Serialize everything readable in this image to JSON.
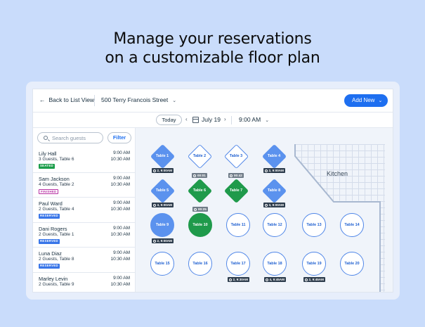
{
  "headline": {
    "line1": "Manage your reservations",
    "line2": "on a customizable floor plan"
  },
  "topbar": {
    "back_label": "Back to List View",
    "address": "500 Terry Francois Street",
    "add_new_label": "Add New"
  },
  "datebar": {
    "today_label": "Today",
    "date": "July 19",
    "time": "9:00 AM"
  },
  "sidebar": {
    "search_placeholder": "Search guests",
    "filter_label": "Filter",
    "guests": [
      {
        "name": "Lily Hall",
        "details": "3 Guests, Table 6",
        "badge": "SEATED",
        "badge_color": "#1b9d4a",
        "time_start": "9:00 AM",
        "time_end": "10:30 AM"
      },
      {
        "name": "Sam Jackson",
        "details": "4 Guests, Table 2",
        "badge": "FINISHED",
        "badge_color": "#b72fa3",
        "time_start": "9:00 AM",
        "time_end": "10:30 AM"
      },
      {
        "name": "Paul Ward",
        "details": "2 Guests, Table 4",
        "badge": "RESERVED",
        "badge_color": "#3875e8",
        "time_start": "9:00 AM",
        "time_end": "10:30 AM"
      },
      {
        "name": "Dani Rogers",
        "details": "2 Guests, Table 1",
        "badge": "RESERVED",
        "badge_color": "#3875e8",
        "time_start": "9:00 AM",
        "time_end": "10:30 AM"
      },
      {
        "name": "Luna Diaz",
        "details": "2 Guests, Table 8",
        "badge": "RESERVED",
        "badge_color": "#3875e8",
        "time_start": "9:00 AM",
        "time_end": "10:30 AM"
      },
      {
        "name": "Marley Levin",
        "details": "2 Guests, Table 9",
        "badge": "",
        "badge_color": "",
        "time_start": "9:00 AM",
        "time_end": "10:30 AM"
      }
    ]
  },
  "floor": {
    "kitchen_label": "Kitchen",
    "tables": [
      {
        "label": "Table 1",
        "shape": "diamond",
        "status": "reserved",
        "tag": "2, 9:00AM",
        "tag_type": "guests"
      },
      {
        "label": "Table 2",
        "shape": "diamond",
        "status": "free",
        "tag": "",
        "tag_type": ""
      },
      {
        "label": "Table 3",
        "shape": "diamond",
        "status": "free",
        "tag": "",
        "tag_type": ""
      },
      {
        "label": "Table 4",
        "shape": "diamond",
        "status": "reserved",
        "tag": "2, 9:00AM",
        "tag_type": "guests"
      },
      {
        "label": "Table 5",
        "shape": "diamond",
        "status": "reserved",
        "tag": "3, 9:00AM",
        "tag_type": "guests"
      },
      {
        "label": "Table 6",
        "shape": "diamond",
        "status": "seated",
        "tag": "00:01",
        "tag_type": "timer"
      },
      {
        "label": "Table 7",
        "shape": "diamond",
        "status": "seated",
        "tag": "00:42",
        "tag_type": "timer"
      },
      {
        "label": "Table 8",
        "shape": "diamond",
        "status": "reserved",
        "tag": "3, 9:00AM",
        "tag_type": "guests"
      },
      {
        "label": "Table 9",
        "shape": "circle",
        "status": "reserved",
        "tag": "2, 9:00AM",
        "tag_type": "guests"
      },
      {
        "label": "Table 10",
        "shape": "circle",
        "status": "seated",
        "tag": "00:25",
        "tag_type": "timer"
      },
      {
        "label": "Table 11",
        "shape": "circle",
        "status": "free",
        "tag": "",
        "tag_type": ""
      },
      {
        "label": "Table 12",
        "shape": "circle",
        "status": "free",
        "tag": "",
        "tag_type": ""
      },
      {
        "label": "Table 13",
        "shape": "circle",
        "status": "free",
        "tag": "",
        "tag_type": ""
      },
      {
        "label": "Table 14",
        "shape": "circle",
        "status": "free",
        "tag": "",
        "tag_type": ""
      },
      {
        "label": "Table 15",
        "shape": "circle",
        "status": "free",
        "tag": "",
        "tag_type": ""
      },
      {
        "label": "Table 16",
        "shape": "circle",
        "status": "free",
        "tag": "",
        "tag_type": ""
      },
      {
        "label": "Table 17",
        "shape": "circle",
        "status": "free",
        "tag": "2, 9:30AM",
        "tag_type": "guests"
      },
      {
        "label": "Table 18",
        "shape": "circle",
        "status": "free",
        "tag": "4, 9:45AM",
        "tag_type": "guests"
      },
      {
        "label": "Table 19",
        "shape": "circle",
        "status": "free",
        "tag": "2, 9:45AM",
        "tag_type": "guests"
      },
      {
        "label": "Table 20",
        "shape": "circle",
        "status": "free",
        "tag": "",
        "tag_type": ""
      }
    ]
  },
  "colors": {
    "accent": "#1e6ff0",
    "reserved": "#5b92ee",
    "seated": "#1f9a4b",
    "free_border": "#4f86e8",
    "page_bg": "#c9dcfb"
  }
}
